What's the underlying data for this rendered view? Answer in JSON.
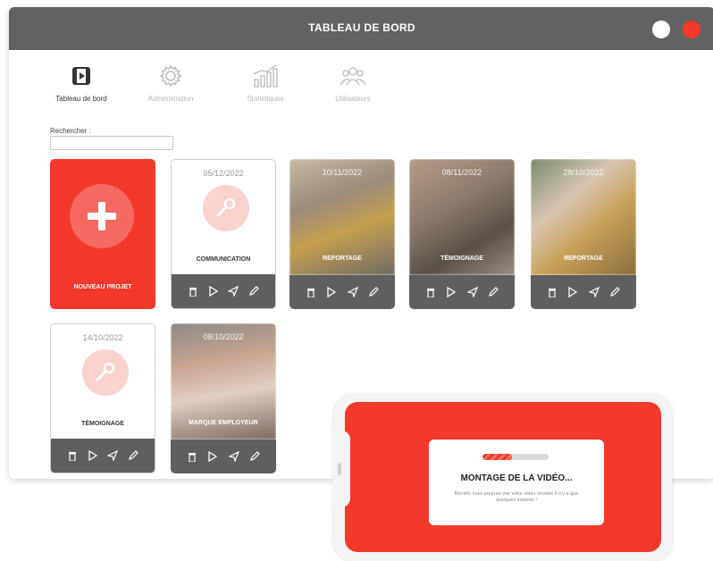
{
  "window": {
    "title": "TABLEAU DE BORD"
  },
  "nav": [
    {
      "label": "Tableau de bord",
      "icon": "film-icon",
      "active": true
    },
    {
      "label": "Administration",
      "icon": "gear-icon",
      "active": false
    },
    {
      "label": "Statistiques",
      "icon": "bar-chart-icon",
      "active": false
    },
    {
      "label": "Utilisateurs",
      "icon": "users-icon",
      "active": false
    }
  ],
  "search": {
    "label": "Rechercher :",
    "value": ""
  },
  "new_project": {
    "label": "NOUVEAU PROJET"
  },
  "projects": [
    {
      "date": "05/12/2022",
      "name": "COMMUNICATION",
      "thumbnail": "placeholder-mic"
    },
    {
      "date": "10/11/2022",
      "name": "REPORTAGE",
      "thumbnail": "photo"
    },
    {
      "date": "08/11/2022",
      "name": "TÉMOIGNAGE",
      "thumbnail": "photo"
    },
    {
      "date": "28/10/2022",
      "name": "REPORTAGE",
      "thumbnail": "photo"
    },
    {
      "date": "14/10/2022",
      "name": "TÉMOIGNAGE",
      "thumbnail": "placeholder-mic"
    },
    {
      "date": "08/10/2022",
      "name": "MARQUE EMPLOYEUR",
      "thumbnail": "photo"
    }
  ],
  "card_actions": [
    "trash-icon",
    "play-icon",
    "send-icon",
    "pencil-icon"
  ],
  "phone": {
    "modal_title": "MONTAGE DE LA VIDÉO...",
    "modal_subtitle": "Bientôt, vous pourrez voir votre vidéo montée Il n'y a que quelques instants !",
    "progress": 0.45
  },
  "colors": {
    "accent": "#f2392b",
    "titlebar": "#626262",
    "action_bar": "#5f5f5f",
    "placeholder_circle": "#fbd2cd"
  }
}
